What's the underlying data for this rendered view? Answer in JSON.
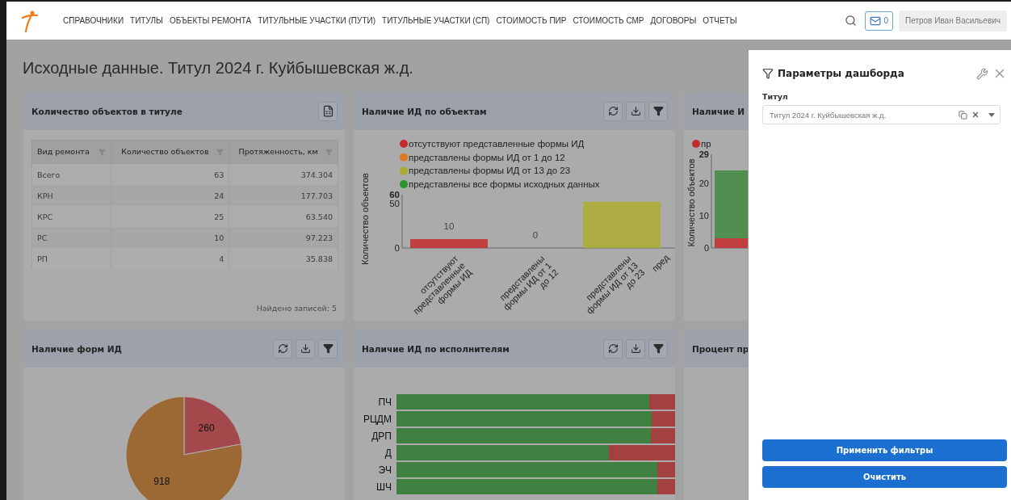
{
  "nav": {
    "items": [
      "СПРАВОЧНИКИ",
      "ТИТУЛЫ",
      "ОБЪЕКТЫ РЕМОНТА",
      "ТИТУЛЬНЫЕ УЧАСТКИ (ПУТИ)",
      "ТИТУЛЬНЫЕ УЧАСТКИ (СП)",
      "СТОИМОСТЬ ПИР",
      "СТОИМОСТЬ СМР",
      "ДОГОВОРЫ",
      "ОТЧЕТЫ"
    ],
    "mail_count": "0",
    "user": "Петров Иван Васильевич"
  },
  "page_title": "Исходные данные. Титул 2024 г. Куйбышевская ж.д.",
  "cards": [
    {
      "kind": "table",
      "title": "Количество объектов в титуле",
      "tools": [
        {
          "kind": "excel"
        }
      ],
      "columns": [
        "Вид ремонта",
        "Количество объектов",
        "Протяженность, км"
      ],
      "rows": [
        [
          "Всего",
          "63",
          "374.304"
        ],
        [
          "КРН",
          "24",
          "177.703"
        ],
        [
          "КРС",
          "25",
          "63.540"
        ],
        [
          "РС",
          "10",
          "97.223"
        ],
        [
          "РП",
          "4",
          "35.838"
        ]
      ],
      "footer": "Найдено записей: 5"
    },
    {
      "kind": "bar_chart",
      "title": "Наличие ИД по объектам",
      "tools": [
        {
          "kind": "refresh"
        },
        {
          "kind": "download"
        },
        {
          "kind": "filter"
        }
      ],
      "chart_data": {
        "type": "bar",
        "legend": "top",
        "ylabel": "Количество объектов",
        "categories": [
          "отсутствуют представленные формы ИД",
          "представлены формы ИД от 1 до 12",
          "представлены формы ИД от 13 до 23",
          "пред"
        ],
        "stacked": true,
        "ylim": [
          0,
          60
        ],
        "yticks": [
          0,
          50,
          60
        ],
        "value_labels": [
          "10",
          "0"
        ],
        "series": [
          {
            "name": "отсутствуют представленные формы ИД",
            "color": "#c42b2b",
            "values": [
              10,
              null,
              null,
              null
            ]
          },
          {
            "name": "представлены формы ИД от 1 до 12",
            "color": "#e07a1f",
            "values": [
              null,
              0,
              null,
              null
            ]
          },
          {
            "name": "представлены формы ИД от 13 до 23",
            "color": "#abab30",
            "values": [
              null,
              null,
              52,
              null
            ]
          },
          {
            "name": "представлены все формы исходных данных",
            "color": "#2c962c",
            "values": [
              null,
              null,
              null,
              null
            ]
          }
        ]
      }
    },
    {
      "kind": "partial_chart",
      "title": "Наличие И",
      "chart_data": {
        "type": "bar",
        "legend": "top",
        "ylabel": "Количество объектов",
        "stacked": true,
        "ylim": [
          0,
          29
        ],
        "yticks": [
          0,
          10,
          20,
          29
        ],
        "series": [
          {
            "name": "пр",
            "color": "#c42b2b",
            "values": [
              3
            ]
          },
          {
            "color": "#3f8a3f",
            "values": [
              21
            ]
          }
        ]
      }
    },
    {
      "kind": "pie",
      "title": "Наличие форм ИД",
      "tools": [
        {
          "kind": "refresh"
        },
        {
          "kind": "download"
        },
        {
          "kind": "filter"
        }
      ],
      "chart_data": {
        "type": "pie",
        "data_labels": true,
        "values": [
          260,
          918
        ]
      }
    },
    {
      "kind": "hbars",
      "title": "Наличие ИД по исполнителям",
      "tools": [
        {
          "kind": "refresh"
        },
        {
          "kind": "download"
        },
        {
          "kind": "filter"
        }
      ],
      "rows": [
        {
          "label": "ПЧ",
          "level": 0.908
        },
        {
          "label": "РЦДМ",
          "level": 0.917
        },
        {
          "label": "ДРП",
          "level": 0.914
        },
        {
          "label": "Д",
          "level": 0.761
        },
        {
          "label": "ЭЧ",
          "level": 0.936
        },
        {
          "label": "ШЧ",
          "level": 0.936
        }
      ]
    },
    {
      "kind": "empty",
      "title": "Процент пр"
    }
  ],
  "drawer": {
    "title": "Параметры дашборда",
    "field_label": "Титул",
    "field_value": "Титул 2024 г. Куйбышевская ж.д.",
    "buttons": [
      "Применить фильтры",
      "Очистить"
    ]
  }
}
